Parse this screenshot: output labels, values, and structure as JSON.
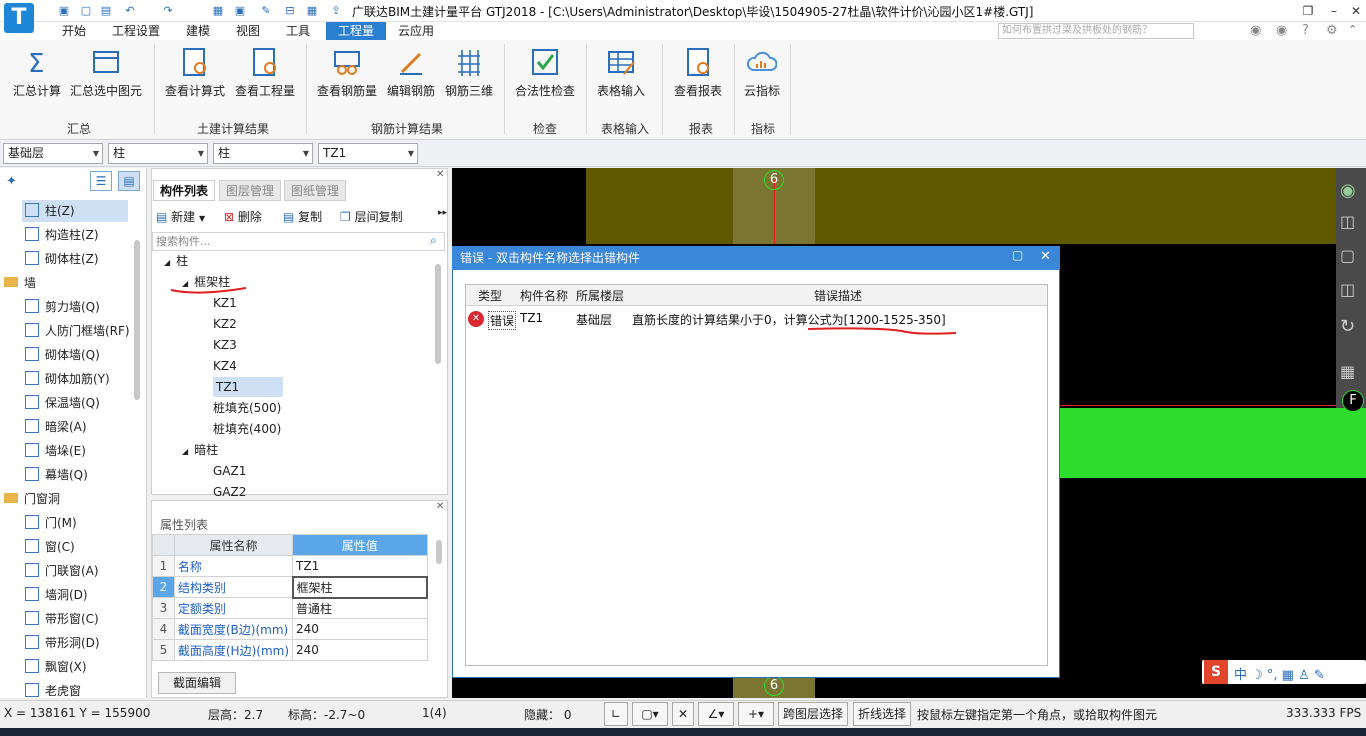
{
  "window": {
    "title": "广联达BIM土建计量平台 GTJ2018 - [C:\\Users\\Administrator\\Desktop\\毕设\\1504905-27杜晶\\软件计价\\沁园小区1#楼.GTJ]",
    "logo_letter": "T",
    "help_search_placeholder": "如何布置拱过梁及拱板处的钢筋？"
  },
  "menu": [
    "开始",
    "工程设置",
    "建模",
    "视图",
    "工具",
    "工程量",
    "云应用"
  ],
  "menu_active": "工程量",
  "ribbon": {
    "buttons": [
      "汇总计算",
      "汇总选中图元",
      "查看计算式",
      "查看工程量",
      "查看钢筋量",
      "编辑钢筋",
      "钢筋三维",
      "合法性检查",
      "表格输入",
      "查看报表",
      "云指标"
    ],
    "groups": [
      "汇总",
      "土建计算结果",
      "钢筋计算结果",
      "检查",
      "表格输入",
      "报表",
      "指标"
    ]
  },
  "combos": [
    "基础层",
    "柱",
    "柱",
    "TZ1"
  ],
  "leftnav": {
    "items": [
      {
        "type": "item",
        "label": "柱(Z)",
        "selected": true
      },
      {
        "type": "item",
        "label": "构造柱(Z)"
      },
      {
        "type": "item",
        "label": "砌体柱(Z)"
      },
      {
        "type": "cat",
        "label": "墙"
      },
      {
        "type": "item",
        "label": "剪力墙(Q)"
      },
      {
        "type": "item",
        "label": "人防门框墙(RF)"
      },
      {
        "type": "item",
        "label": "砌体墙(Q)"
      },
      {
        "type": "item",
        "label": "砌体加筋(Y)"
      },
      {
        "type": "item",
        "label": "保温墙(Q)"
      },
      {
        "type": "item",
        "label": "暗梁(A)"
      },
      {
        "type": "item",
        "label": "墙垛(E)"
      },
      {
        "type": "item",
        "label": "幕墙(Q)"
      },
      {
        "type": "cat",
        "label": "门窗洞"
      },
      {
        "type": "item",
        "label": "门(M)"
      },
      {
        "type": "item",
        "label": "窗(C)"
      },
      {
        "type": "item",
        "label": "门联窗(A)"
      },
      {
        "type": "item",
        "label": "墙洞(D)"
      },
      {
        "type": "item",
        "label": "带形窗(C)"
      },
      {
        "type": "item",
        "label": "带形洞(D)"
      },
      {
        "type": "item",
        "label": "飘窗(X)"
      },
      {
        "type": "item",
        "label": "老虎窗"
      }
    ]
  },
  "component_panel": {
    "tabs": [
      "构件列表",
      "图层管理",
      "图纸管理"
    ],
    "toolbar": [
      "新建",
      "删除",
      "复制",
      "层间复制"
    ],
    "search_placeholder": "搜索构件...",
    "tree": [
      {
        "label": "柱",
        "level": 0,
        "expander": "◢"
      },
      {
        "label": "框架柱",
        "level": 1,
        "expander": "◢"
      },
      {
        "label": "KZ1",
        "level": 2
      },
      {
        "label": "KZ2",
        "level": 2
      },
      {
        "label": "KZ3",
        "level": 2
      },
      {
        "label": "KZ4",
        "level": 2
      },
      {
        "label": "TZ1",
        "level": 2,
        "selected": true
      },
      {
        "label": "桩填充(500)",
        "level": 2
      },
      {
        "label": "桩填充(400)",
        "level": 2
      },
      {
        "label": "暗柱",
        "level": 1,
        "expander": "◢"
      },
      {
        "label": "GAZ1",
        "level": 2
      },
      {
        "label": "GAZ2",
        "level": 2
      }
    ]
  },
  "property_panel": {
    "title": "属性列表",
    "headers": [
      "属性名称",
      "属性值"
    ],
    "rows": [
      {
        "num": "1",
        "name": "名称",
        "value": "TZ1"
      },
      {
        "num": "2",
        "name": "结构类别",
        "value": "框架柱"
      },
      {
        "num": "3",
        "name": "定额类别",
        "value": "普通柱"
      },
      {
        "num": "4",
        "name": "截面宽度(B边)(mm)",
        "value": "240"
      },
      {
        "num": "5",
        "name": "截面高度(H边)(mm)",
        "value": "240"
      }
    ],
    "section_edit_button": "截面编辑"
  },
  "dialog": {
    "title": "错误 - 双击构件名称选择出错构件",
    "headers": [
      "类型",
      "构件名称",
      "所属楼层",
      "错误描述"
    ],
    "rows": [
      {
        "type": "错误",
        "component": "TZ1",
        "floor": "基础层",
        "description": "直筋长度的计算结果小于0，计算公式为[1200-1525-350]"
      }
    ]
  },
  "canvas": {
    "axis_labels": [
      "6",
      "6",
      "F"
    ]
  },
  "statusbar": {
    "coords": "X = 138161 Y = 155900",
    "floor_height": "层高：2.7",
    "elevation": "标高：-2.7~0",
    "count": "1(4)",
    "hidden": "隐藏：  0",
    "buttons": [
      "跨图层选择",
      "折线选择"
    ],
    "hint": "按鼠标左键指定第一个角点，或拾取构件图元",
    "fps": "333.333 FPS"
  },
  "colors": {
    "accent": "#2b7fd1",
    "dialog_title": "#3a86d8",
    "beam_olive": "#5f5a00",
    "slab_green": "#2ddc2d",
    "error_red": "#d9282f"
  }
}
